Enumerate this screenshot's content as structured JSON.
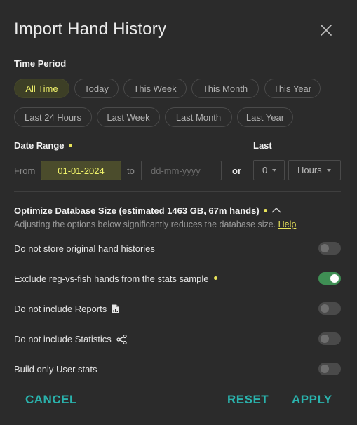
{
  "dialog": {
    "title": "Import Hand History"
  },
  "time_period": {
    "label": "Time Period",
    "chips": [
      {
        "label": "All Time",
        "active": true
      },
      {
        "label": "Today",
        "active": false
      },
      {
        "label": "This Week",
        "active": false
      },
      {
        "label": "This Month",
        "active": false
      },
      {
        "label": "This Year",
        "active": false
      },
      {
        "label": "Last 24 Hours",
        "active": false
      },
      {
        "label": "Last Week",
        "active": false
      },
      {
        "label": "Last Month",
        "active": false
      },
      {
        "label": "Last Year",
        "active": false
      }
    ]
  },
  "date_range": {
    "label": "Date Range",
    "from_label": "From",
    "from_value": "01-01-2024",
    "to_label": "to",
    "to_placeholder": "dd-mm-yyyy",
    "or_label": "or"
  },
  "last": {
    "label": "Last",
    "amount": "0",
    "unit": "Hours"
  },
  "optimize": {
    "title": "Optimize Database Size (estimated 1463 GB, 67m hands)",
    "subtitle": "Adjusting the options below significantly reduces the database size.",
    "help_link": "Help"
  },
  "options": [
    {
      "label": "Do not store original hand histories",
      "on": false
    },
    {
      "label": "Exclude reg-vs-fish hands from the stats sample",
      "on": true
    },
    {
      "label": "Do not include Reports",
      "on": false
    },
    {
      "label": "Do not include Statistics",
      "on": false
    },
    {
      "label": "Build only User stats",
      "on": false
    }
  ],
  "footer": {
    "cancel": "CANCEL",
    "reset": "RESET",
    "apply": "APPLY"
  },
  "colors": {
    "background": "#2b2b2b",
    "accent_yellow": "#eef06a",
    "toggle_on": "#3f8f54",
    "button_teal": "#2ab3ad"
  }
}
